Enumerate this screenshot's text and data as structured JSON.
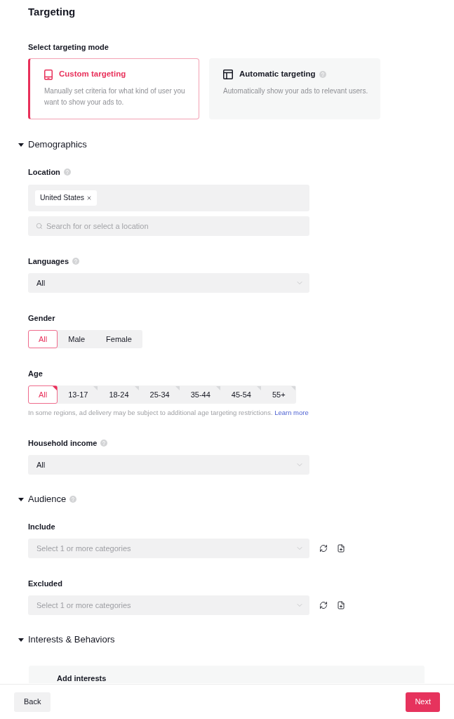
{
  "page": {
    "title": "Targeting"
  },
  "targeting_mode": {
    "label": "Select targeting mode",
    "options": [
      {
        "kind": "custom",
        "title": "Custom targeting",
        "description": "Manually set criteria for what kind of user you want to show your ads to.",
        "selected": true
      },
      {
        "kind": "automatic",
        "title": "Automatic targeting",
        "help": true,
        "description": "Automatically show your ads to relevant users.",
        "selected": false
      }
    ]
  },
  "sections": [
    {
      "title": "Demographics",
      "expanded": true,
      "fields": [
        {
          "kind": "tags",
          "label": "Location",
          "help": true,
          "tags": [
            "United States"
          ],
          "placeholder": "Search for or select a location"
        },
        {
          "kind": "select",
          "label": "Languages",
          "help": true,
          "value": "All"
        },
        {
          "kind": "segmented",
          "label": "Gender",
          "options": [
            {
              "label": "All",
              "selected": true
            },
            {
              "label": "Male",
              "selected": false
            },
            {
              "label": "Female",
              "selected": false
            }
          ]
        },
        {
          "kind": "segmented",
          "label": "Age",
          "options": [
            {
              "label": "All",
              "selected": true,
              "corner_mark": true
            },
            {
              "label": "13-17",
              "selected": false,
              "corner_mark": true
            },
            {
              "label": "18-24",
              "selected": false,
              "corner_mark": true
            },
            {
              "label": "25-34",
              "selected": false,
              "corner_mark": true
            },
            {
              "label": "35-44",
              "selected": false,
              "corner_mark": true
            },
            {
              "label": "45-54",
              "selected": false,
              "corner_mark": true
            },
            {
              "label": "55+",
              "selected": false,
              "corner_mark": true
            }
          ],
          "note": "In some regions, ad delivery may be subject to additional age targeting restrictions.",
          "note_link": "Learn more"
        },
        {
          "kind": "select",
          "label": "Household income",
          "help": true,
          "value": "All"
        }
      ]
    },
    {
      "title": "Audience",
      "expanded": true,
      "help": true,
      "fields": [
        {
          "kind": "select",
          "label": "Include",
          "placeholder": "Select 1 or more categories",
          "tools": true
        },
        {
          "kind": "select",
          "label": "Excluded",
          "placeholder": "Select 1 or more categories",
          "tools": true
        }
      ]
    },
    {
      "title": "Interests & Behaviors",
      "expanded": true,
      "fields": [
        {
          "kind": "card",
          "label": "Add interests"
        }
      ]
    }
  ],
  "footer": {
    "buttons": [
      {
        "kind": "secondary",
        "label": "Back"
      },
      {
        "kind": "primary",
        "label": "Next"
      }
    ]
  }
}
